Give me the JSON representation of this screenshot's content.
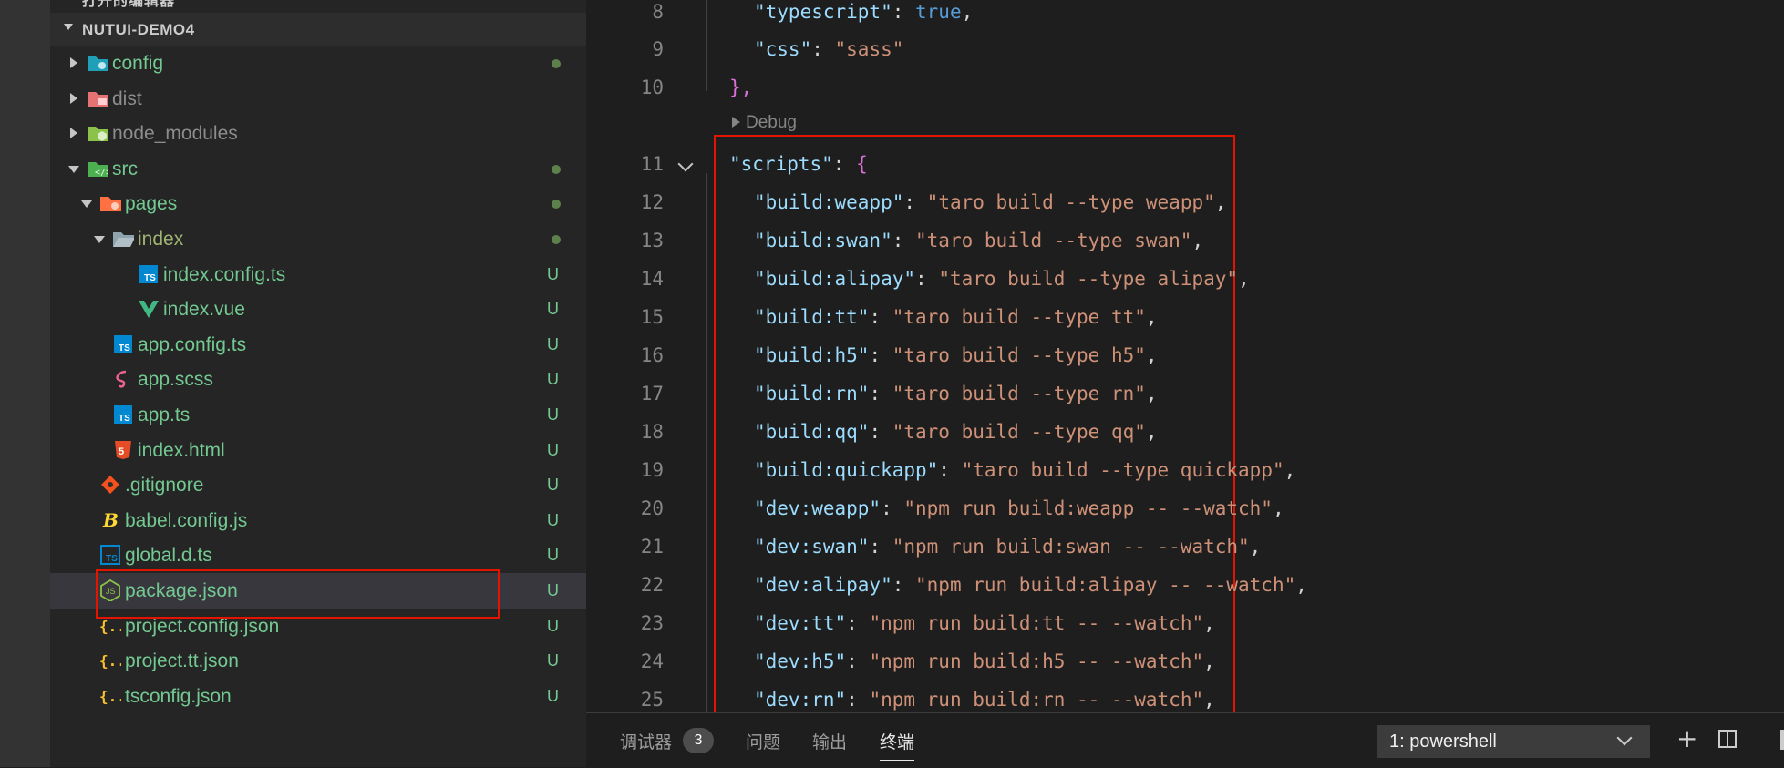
{
  "explorer": {
    "prev_section_title": "打开的编辑器",
    "project_title": "NUTUI-DEMO4",
    "items": [
      {
        "label": "config",
        "status": "dot",
        "icon": "folder-config-icon"
      },
      {
        "label": "dist",
        "status": "",
        "icon": "folder-dist-icon"
      },
      {
        "label": "node_modules",
        "status": "",
        "icon": "folder-node-icon"
      },
      {
        "label": "src",
        "status": "dot",
        "icon": "folder-src-icon"
      },
      {
        "label": "pages",
        "status": "dot",
        "icon": "folder-pages-icon"
      },
      {
        "label": "index",
        "status": "dot",
        "icon": "folder-open-icon"
      },
      {
        "label": "index.config.ts",
        "status": "U",
        "icon": "typescript-icon"
      },
      {
        "label": "index.vue",
        "status": "U",
        "icon": "vue-icon"
      },
      {
        "label": "app.config.ts",
        "status": "U",
        "icon": "typescript-icon"
      },
      {
        "label": "app.scss",
        "status": "U",
        "icon": "sass-icon"
      },
      {
        "label": "app.ts",
        "status": "U",
        "icon": "typescript-icon"
      },
      {
        "label": "index.html",
        "status": "U",
        "icon": "html5-icon"
      },
      {
        "label": ".gitignore",
        "status": "U",
        "icon": "git-icon"
      },
      {
        "label": "babel.config.js",
        "status": "U",
        "icon": "babel-icon"
      },
      {
        "label": "global.d.ts",
        "status": "U",
        "icon": "typescript-def-icon"
      },
      {
        "label": "package.json",
        "status": "U",
        "icon": "nodejs-icon"
      },
      {
        "label": "project.config.json",
        "status": "U",
        "icon": "json-icon"
      },
      {
        "label": "project.tt.json",
        "status": "U",
        "icon": "json-icon"
      },
      {
        "label": "tsconfig.json",
        "status": "U",
        "icon": "json-icon"
      }
    ]
  },
  "editor": {
    "codelens": "Debug",
    "lines": [
      {
        "n": "8",
        "key": "\"typescript\"",
        "val": "true",
        "kind": "bool",
        "tail": ","
      },
      {
        "n": "9",
        "key": "\"css\"",
        "val": "\"sass\"",
        "kind": "str",
        "tail": ""
      },
      {
        "n": "10",
        "key": "",
        "val": "",
        "kind": "close",
        "tail": "},"
      },
      {
        "n": "11",
        "key": "\"scripts\"",
        "val": "{",
        "kind": "open",
        "tail": ""
      },
      {
        "n": "12",
        "key": "\"build:weapp\"",
        "val": "\"taro build --type weapp\"",
        "kind": "str",
        "tail": ","
      },
      {
        "n": "13",
        "key": "\"build:swan\"",
        "val": "\"taro build --type swan\"",
        "kind": "str",
        "tail": ","
      },
      {
        "n": "14",
        "key": "\"build:alipay\"",
        "val": "\"taro build --type alipay\"",
        "kind": "str",
        "tail": ","
      },
      {
        "n": "15",
        "key": "\"build:tt\"",
        "val": "\"taro build --type tt\"",
        "kind": "str",
        "tail": ","
      },
      {
        "n": "16",
        "key": "\"build:h5\"",
        "val": "\"taro build --type h5\"",
        "kind": "str",
        "tail": ","
      },
      {
        "n": "17",
        "key": "\"build:rn\"",
        "val": "\"taro build --type rn\"",
        "kind": "str",
        "tail": ","
      },
      {
        "n": "18",
        "key": "\"build:qq\"",
        "val": "\"taro build --type qq\"",
        "kind": "str",
        "tail": ","
      },
      {
        "n": "19",
        "key": "\"build:quickapp\"",
        "val": "\"taro build --type quickapp\"",
        "kind": "str",
        "tail": ","
      },
      {
        "n": "20",
        "key": "\"dev:weapp\"",
        "val": "\"npm run build:weapp -- --watch\"",
        "kind": "str",
        "tail": ","
      },
      {
        "n": "21",
        "key": "\"dev:swan\"",
        "val": "\"npm run build:swan -- --watch\"",
        "kind": "str",
        "tail": ","
      },
      {
        "n": "22",
        "key": "\"dev:alipay\"",
        "val": "\"npm run build:alipay -- --watch\"",
        "kind": "str",
        "tail": ","
      },
      {
        "n": "23",
        "key": "\"dev:tt\"",
        "val": "\"npm run build:tt -- --watch\"",
        "kind": "str",
        "tail": ","
      },
      {
        "n": "24",
        "key": "\"dev:h5\"",
        "val": "\"npm run build:h5 -- --watch\"",
        "kind": "str",
        "tail": ","
      },
      {
        "n": "25",
        "key": "\"dev:rn\"",
        "val": "\"npm run build:rn -- --watch\"",
        "kind": "str",
        "tail": ","
      }
    ]
  },
  "panel": {
    "tabs": [
      "调试器",
      "问题",
      "输出",
      "终端"
    ],
    "debug_count": "3",
    "terminal_select": "1: powershell",
    "add_label": "+"
  }
}
